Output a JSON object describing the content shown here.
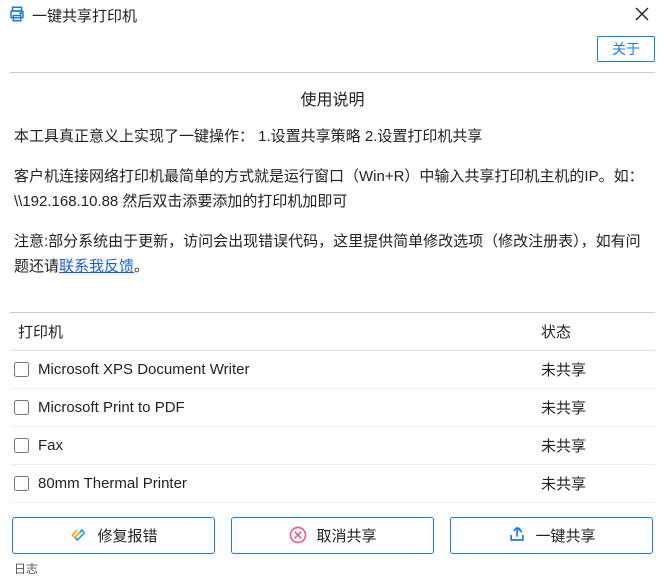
{
  "window": {
    "title": "一键共享打印机"
  },
  "header": {
    "about_label": "关于"
  },
  "instructions": {
    "title": "使用说明",
    "line1": "本工具真正意义上实现了一键操作： 1.设置共享策略 2.设置打印机共享",
    "line2": "客户机连接网络打印机最简单的方式就是运行窗口（Win+R）中输入共享打印机主机的IP。如：\\\\192.168.10.88 然后双击添要添加的打印机加即可",
    "line3_before": "注意:部分系统由于更新，访问会出现错误代码，这里提供简单修改选项（修改注册表），如有问题还请",
    "line3_link": "联系我反馈",
    "line3_after": "。"
  },
  "table": {
    "header_name": "打印机",
    "header_state": "状态",
    "rows": [
      {
        "name": "Microsoft XPS Document Writer",
        "state": "未共享",
        "checked": false
      },
      {
        "name": "Microsoft Print to PDF",
        "state": "未共享",
        "checked": false
      },
      {
        "name": "Fax",
        "state": "未共享",
        "checked": false
      },
      {
        "name": "80mm Thermal Printer",
        "state": "未共享",
        "checked": false
      }
    ]
  },
  "actions": {
    "repair_label": "修复报错",
    "cancel_label": "取消共享",
    "share_label": "一键共享"
  },
  "footer": {
    "log_label": "日志"
  },
  "colors": {
    "accent": "#1f7bd8"
  }
}
